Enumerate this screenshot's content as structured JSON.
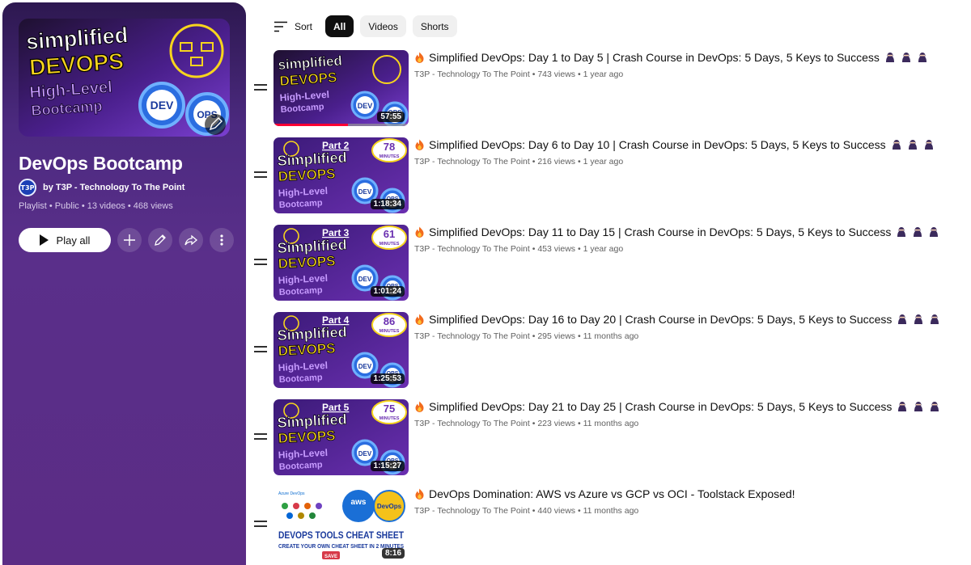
{
  "colors": {
    "panel_top": "#2d1850",
    "panel_bottom": "#5b2c85",
    "thumb_purple": "#6a2fb0",
    "thumb_yellow": "#f7d51d",
    "progress_red": "#ff0033",
    "chip_active": "#0f0f0f"
  },
  "playlist": {
    "title": "DevOps Bootcamp",
    "owner_avatar_text": "T3P",
    "owner": "by T3P - Technology To The Point",
    "meta": "Playlist • Public • 13 videos • 468 views",
    "play_all_label": "Play all",
    "cover": {
      "line1": "simplified",
      "line2": "DEVOPS",
      "line3": "High-Level",
      "line4": "Bootcamp",
      "badge_dev": "DEV",
      "badge_ops": "OPS"
    },
    "icons": [
      "play-icon",
      "add-icon",
      "edit-icon",
      "share-icon",
      "more-vert-icon",
      "pencil-icon"
    ]
  },
  "filters": {
    "sort_label": "Sort",
    "chips": [
      "All",
      "Videos",
      "Shorts"
    ],
    "active": "All"
  },
  "videos": [
    {
      "title": "Simplified DevOps: Day 1 to Day 5 | Crash Course in DevOps: 5 Days, 5 Keys to Success",
      "channel": "T3P - Technology To The Point",
      "views": "743 views",
      "age": "1 year ago",
      "duration": "57:55",
      "watched": 0.55,
      "thumb_style": "cover",
      "thumb_lines": [
        "simplified",
        "DEVOPS",
        "High-Level",
        "Bootcamp"
      ],
      "badge_dev": "DEV",
      "badge_ops": "OPS"
    },
    {
      "title": "Simplified DevOps: Day 6 to Day 10 | Crash Course in DevOps: 5 Days, 5 Keys to Success",
      "channel": "T3P - Technology To The Point",
      "views": "216 views",
      "age": "1 year ago",
      "duration": "1:18:34",
      "watched": 0,
      "thumb_style": "part",
      "part": "Part 2",
      "minutes_num": "78",
      "minutes_label": "MINUTES",
      "thumb_lines": [
        "Simplified",
        "DEVOPS",
        "High-Level",
        "Bootcamp"
      ],
      "badge_dev": "DEV",
      "badge_ops": "OPS"
    },
    {
      "title": "Simplified DevOps: Day 11 to Day 15 | Crash Course in DevOps: 5 Days, 5 Keys to Success",
      "channel": "T3P - Technology To The Point",
      "views": "453 views",
      "age": "1 year ago",
      "duration": "1:01:24",
      "watched": 0,
      "thumb_style": "part",
      "part": "Part 3",
      "minutes_num": "61",
      "minutes_label": "MINUTES",
      "thumb_lines": [
        "Simplified",
        "DEVOPS",
        "High-Level",
        "Bootcamp"
      ],
      "badge_dev": "DEV",
      "badge_ops": "OPS"
    },
    {
      "title": "Simplified DevOps: Day 16 to Day 20 | Crash Course in DevOps: 5 Days, 5 Keys to Success",
      "channel": "T3P - Technology To The Point",
      "views": "295 views",
      "age": "11 months ago",
      "duration": "1:25:53",
      "watched": 0,
      "thumb_style": "part",
      "part": "Part 4",
      "minutes_num": "86",
      "minutes_label": "MINUTES",
      "thumb_lines": [
        "Simplified",
        "DEVOPS",
        "High-Level",
        "Bootcamp"
      ],
      "badge_dev": "DEV",
      "badge_ops": "OPS"
    },
    {
      "title": "Simplified DevOps: Day 21 to Day 25 | Crash Course in DevOps: 5 Days, 5 Keys to Success",
      "channel": "T3P - Technology To The Point",
      "views": "223 views",
      "age": "11 months ago",
      "duration": "1:15:27",
      "watched": 0,
      "thumb_style": "part",
      "part": "Part 5",
      "minutes_num": "75",
      "minutes_label": "MINUTES",
      "thumb_lines": [
        "Simplified",
        "DEVOPS",
        "High-Level",
        "Bootcamp"
      ],
      "badge_dev": "DEV",
      "badge_ops": "OPS"
    },
    {
      "title": "DevOps Domination: AWS vs Azure vs GCP vs OCI - Toolstack Exposed!",
      "channel": "T3P - Technology To The Point",
      "views": "440 views",
      "age": "11 months ago",
      "duration": "8:16",
      "watched": 0,
      "thumb_style": "cheatsheet",
      "cs_brand": "Azure DevOps",
      "cs_aws": "aws",
      "cs_devops": "DevOps",
      "cs_line1": "DEVOPS TOOLS CHEAT SHEET",
      "cs_line2": "CREATE YOUR OWN CHEAT SHEET IN 2 MINUTES",
      "cs_badge": "SAVE"
    }
  ]
}
